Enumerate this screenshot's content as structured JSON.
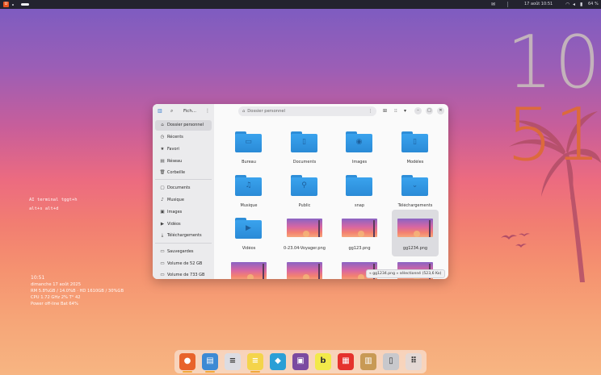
{
  "topbar": {
    "menu_glyph": "U",
    "mail_icon": "mail-icon",
    "date_time": "17 août   10:51",
    "battery": "64 %"
  },
  "clock": {
    "hours": "10",
    "minutes": "51"
  },
  "hint": {
    "line1": "AI terminal tggt+h",
    "line2": "alt+s   alt+d"
  },
  "sysinfo": {
    "time": "10:51",
    "date": "dimanche 17 août 2025",
    "ram": "RM 5.8%GB / 14.0%B · HD 1610GB / 30%GB",
    "cpu": "CPU 1.72 GHz 2%  T° 42",
    "power": "Power off-line Bat 64%"
  },
  "window": {
    "sidebar_title": "Fich...",
    "path": "Dossier personnel",
    "sidebar": [
      {
        "label": "Dossier personnel",
        "icon": "home-icon",
        "glyph": "⌂"
      },
      {
        "label": "Récents",
        "icon": "clock-icon",
        "glyph": "◷"
      },
      {
        "label": "Favori",
        "icon": "star-icon",
        "glyph": "★"
      },
      {
        "label": "Réseau",
        "icon": "network-icon",
        "glyph": "▤"
      },
      {
        "label": "Corbeille",
        "icon": "trash-icon",
        "glyph": "🗑"
      },
      {
        "label": "Documents",
        "icon": "document-icon",
        "glyph": "▢"
      },
      {
        "label": "Musique",
        "icon": "music-icon",
        "glyph": "♪"
      },
      {
        "label": "Images",
        "icon": "image-icon",
        "glyph": "▣"
      },
      {
        "label": "Vidéos",
        "icon": "video-icon",
        "glyph": "▶"
      },
      {
        "label": "Téléchargements",
        "icon": "download-icon",
        "glyph": "⤓"
      },
      {
        "label": "Sauvegardes",
        "icon": "drive-icon",
        "glyph": "▭"
      },
      {
        "label": "Volume de 52 GB",
        "icon": "drive-icon",
        "glyph": "▭"
      },
      {
        "label": "Volume de 733 GB",
        "icon": "drive-icon",
        "glyph": "▭"
      }
    ],
    "files": [
      {
        "label": "Bureau",
        "kind": "folder",
        "glyph": "▭"
      },
      {
        "label": "Documents",
        "kind": "folder",
        "glyph": "▯"
      },
      {
        "label": "Images",
        "kind": "folder",
        "glyph": "◉"
      },
      {
        "label": "Modèles",
        "kind": "folder",
        "glyph": "▯"
      },
      {
        "label": "Musique",
        "kind": "folder",
        "glyph": "♫"
      },
      {
        "label": "Public",
        "kind": "folder",
        "glyph": "⚲"
      },
      {
        "label": "snap",
        "kind": "folder",
        "glyph": ""
      },
      {
        "label": "Téléchargements",
        "kind": "folder",
        "glyph": "⌄"
      },
      {
        "label": "Vidéos",
        "kind": "folder",
        "glyph": "▶"
      },
      {
        "label": "0-23.04-Voyager.png",
        "kind": "image",
        "glyph": ""
      },
      {
        "label": "gg123.png",
        "kind": "image",
        "glyph": ""
      },
      {
        "label": "gg1234.png",
        "kind": "image",
        "glyph": "",
        "selected": true
      },
      {
        "label": "",
        "kind": "image",
        "glyph": ""
      },
      {
        "label": "",
        "kind": "image",
        "glyph": ""
      },
      {
        "label": "",
        "kind": "image",
        "glyph": ""
      },
      {
        "label": "",
        "kind": "image",
        "glyph": ""
      }
    ],
    "status": "« gg1234.png » sélectionné (523,6 Ko)"
  },
  "dock": {
    "apps": [
      {
        "name": "firefox",
        "color": "#e8632b",
        "glyph": "●"
      },
      {
        "name": "files",
        "color": "#3d8ad4",
        "glyph": "▤"
      },
      {
        "name": "text-editor",
        "color": "#dcdce2",
        "glyph": "≡"
      },
      {
        "name": "notes",
        "color": "#f4d44b",
        "glyph": "≡"
      },
      {
        "name": "app-store",
        "color": "#2a9fd6",
        "glyph": "◆"
      },
      {
        "name": "image-viewer",
        "color": "#7b4aa0",
        "glyph": "▣"
      },
      {
        "name": "bobby",
        "color": "#f2e94a",
        "glyph": "b"
      },
      {
        "name": "flathub",
        "color": "#e5322d",
        "glyph": "▦"
      },
      {
        "name": "radio",
        "color": "#c89a55",
        "glyph": "▥"
      },
      {
        "name": "trash",
        "color": "#c8c8cc",
        "glyph": "▯"
      },
      {
        "name": "app-grid",
        "color": "#e4d8d4",
        "glyph": "⠿"
      }
    ],
    "running": [
      "firefox",
      "files",
      "notes"
    ]
  }
}
